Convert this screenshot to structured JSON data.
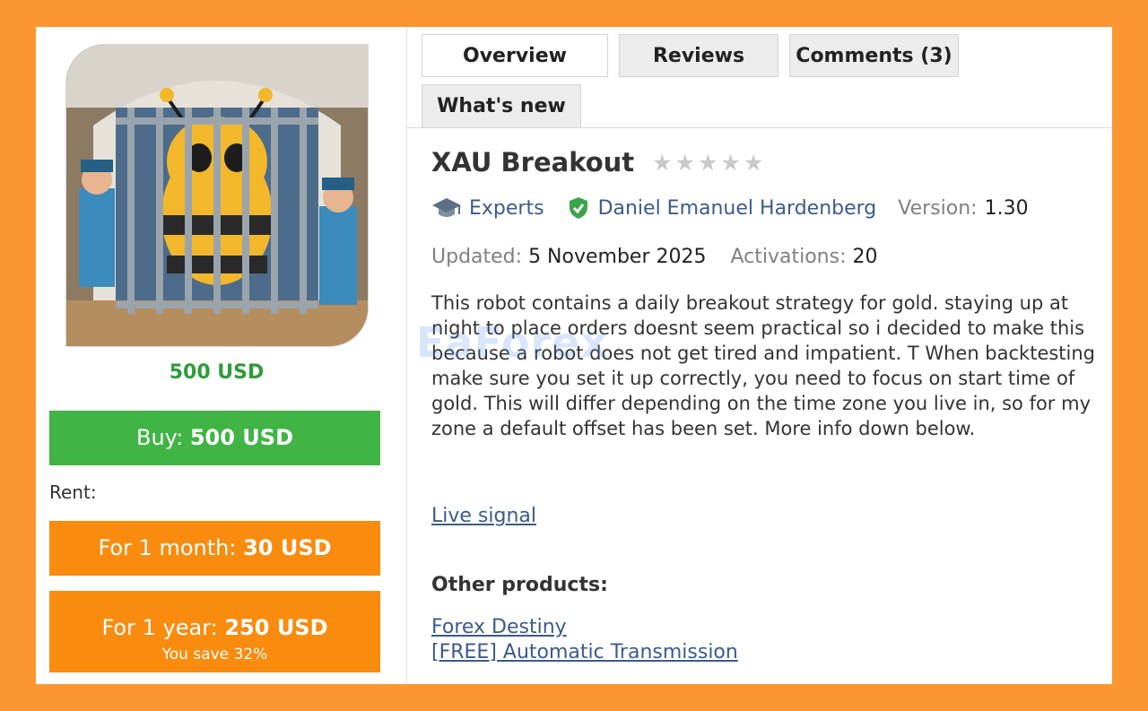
{
  "product": {
    "price_label": "500 USD",
    "buy_prefix": "Buy:",
    "buy_price": "500 USD",
    "rent_label": "Rent:",
    "month_prefix": "For 1 month:",
    "month_price": "30 USD",
    "year_prefix": "For 1 year:",
    "year_price": "250 USD",
    "year_saving": "You save 32%"
  },
  "tabs": [
    {
      "label": "Overview",
      "active": true
    },
    {
      "label": "Reviews",
      "active": false
    },
    {
      "label": "Comments (3)",
      "active": false
    },
    {
      "label": "What's new",
      "active": false
    }
  ],
  "details": {
    "title": "XAU Breakout",
    "rating_stars": 0,
    "category": "Experts",
    "author": "Daniel Emanuel Hardenberg",
    "version_label": "Version:",
    "version": "1.30",
    "updated_label": "Updated:",
    "updated": "5 November 2025",
    "activations_label": "Activations:",
    "activations": "20",
    "description": "This robot contains a daily breakout strategy for gold. staying up at night to place orders doesnt seem practical so i decided to make this because a robot does not get tired and impatient. T When backtesting make sure you set it up correctly, you need to focus on start time of gold. This will differ depending on the time zone you live in, so for my zone a default offset has been set. More info down below.",
    "live_signal": "Live signal",
    "other_products_label": "Other products:",
    "other_products": [
      "Forex Destiny",
      "[FREE] Automatic Transmission "
    ]
  },
  "watermark": "EaForex",
  "colors": {
    "background": "#fb9630",
    "buy_button": "#40b444",
    "rent_button": "#f98b0e",
    "price_text": "#2e9b3a",
    "link": "#3c5a8c",
    "verified_badge": "#3aa54a"
  }
}
